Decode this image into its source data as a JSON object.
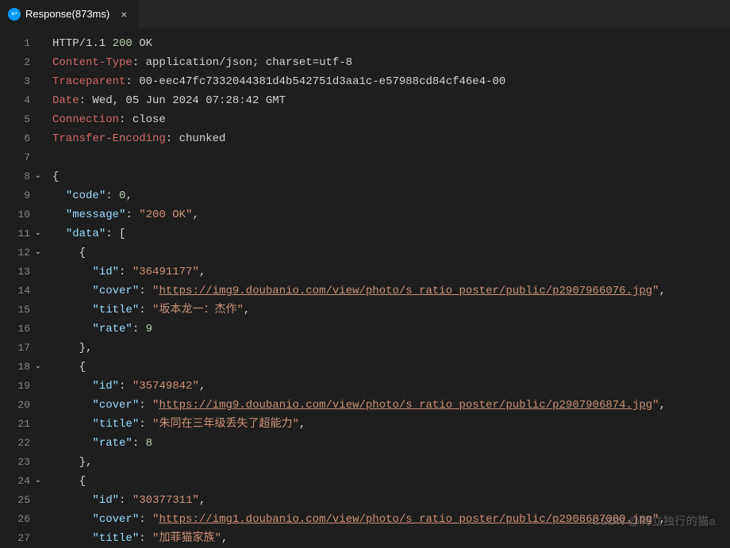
{
  "tab": {
    "title": "Response(873ms)",
    "close_glyph": "×"
  },
  "watermark": "CSDN @特立独行的猫a",
  "lines": [
    {
      "n": "1",
      "fold": "",
      "segs": [
        {
          "t": "HTTP/1.1 ",
          "c": "c-white"
        },
        {
          "t": "200",
          "c": "c-green"
        },
        {
          "t": " OK",
          "c": "c-white"
        }
      ]
    },
    {
      "n": "2",
      "fold": "",
      "segs": [
        {
          "t": "Content-Type",
          "c": "c-red"
        },
        {
          "t": ": application/json; charset=utf-8",
          "c": "c-white"
        }
      ]
    },
    {
      "n": "3",
      "fold": "",
      "segs": [
        {
          "t": "Traceparent",
          "c": "c-red"
        },
        {
          "t": ": 00-eec47fc7332044381d4b542751d3aa1c-e57988cd84cf46e4-00",
          "c": "c-white"
        }
      ]
    },
    {
      "n": "4",
      "fold": "",
      "segs": [
        {
          "t": "Date",
          "c": "c-red"
        },
        {
          "t": ": Wed, 05 Jun 2024 07:28:42 GMT",
          "c": "c-white"
        }
      ]
    },
    {
      "n": "5",
      "fold": "",
      "segs": [
        {
          "t": "Connection",
          "c": "c-red"
        },
        {
          "t": ": close",
          "c": "c-white"
        }
      ]
    },
    {
      "n": "6",
      "fold": "",
      "segs": [
        {
          "t": "Transfer-Encoding",
          "c": "c-red"
        },
        {
          "t": ": chunked",
          "c": "c-white"
        }
      ]
    },
    {
      "n": "7",
      "fold": "",
      "segs": [
        {
          "t": " ",
          "c": "c-white"
        }
      ]
    },
    {
      "n": "8",
      "fold": "v",
      "segs": [
        {
          "t": "{",
          "c": "c-punc"
        }
      ]
    },
    {
      "n": "9",
      "fold": "",
      "segs": [
        {
          "t": "  ",
          "c": "c-punc"
        },
        {
          "t": "\"code\"",
          "c": "c-key"
        },
        {
          "t": ": ",
          "c": "c-punc"
        },
        {
          "t": "0",
          "c": "c-green"
        },
        {
          "t": ",",
          "c": "c-punc"
        }
      ]
    },
    {
      "n": "10",
      "fold": "",
      "segs": [
        {
          "t": "  ",
          "c": "c-punc"
        },
        {
          "t": "\"message\"",
          "c": "c-key"
        },
        {
          "t": ": ",
          "c": "c-punc"
        },
        {
          "t": "\"200 OK\"",
          "c": "c-str"
        },
        {
          "t": ",",
          "c": "c-punc"
        }
      ]
    },
    {
      "n": "11",
      "fold": "v",
      "segs": [
        {
          "t": "  ",
          "c": "c-punc"
        },
        {
          "t": "\"data\"",
          "c": "c-key"
        },
        {
          "t": ": [",
          "c": "c-punc"
        }
      ]
    },
    {
      "n": "12",
      "fold": "v",
      "segs": [
        {
          "t": "    {",
          "c": "c-punc"
        }
      ]
    },
    {
      "n": "13",
      "fold": "",
      "segs": [
        {
          "t": "      ",
          "c": "c-punc"
        },
        {
          "t": "\"id\"",
          "c": "c-key"
        },
        {
          "t": ": ",
          "c": "c-punc"
        },
        {
          "t": "\"36491177\"",
          "c": "c-str"
        },
        {
          "t": ",",
          "c": "c-punc"
        }
      ]
    },
    {
      "n": "14",
      "fold": "",
      "segs": [
        {
          "t": "      ",
          "c": "c-punc"
        },
        {
          "t": "\"cover\"",
          "c": "c-key"
        },
        {
          "t": ": ",
          "c": "c-punc"
        },
        {
          "t": "\"",
          "c": "c-str"
        },
        {
          "t": "https://img9.doubanio.com/view/photo/s_ratio_poster/public/p2907966076.jpg",
          "c": "c-link"
        },
        {
          "t": "\"",
          "c": "c-str"
        },
        {
          "t": ",",
          "c": "c-punc"
        }
      ]
    },
    {
      "n": "15",
      "fold": "",
      "segs": [
        {
          "t": "      ",
          "c": "c-punc"
        },
        {
          "t": "\"title\"",
          "c": "c-key"
        },
        {
          "t": ": ",
          "c": "c-punc"
        },
        {
          "t": "\"坂本龙一：杰作\"",
          "c": "c-str"
        },
        {
          "t": ",",
          "c": "c-punc"
        }
      ]
    },
    {
      "n": "16",
      "fold": "",
      "segs": [
        {
          "t": "      ",
          "c": "c-punc"
        },
        {
          "t": "\"rate\"",
          "c": "c-key"
        },
        {
          "t": ": ",
          "c": "c-punc"
        },
        {
          "t": "9",
          "c": "c-green"
        }
      ]
    },
    {
      "n": "17",
      "fold": "",
      "segs": [
        {
          "t": "    },",
          "c": "c-punc"
        }
      ]
    },
    {
      "n": "18",
      "fold": "v",
      "segs": [
        {
          "t": "    {",
          "c": "c-punc"
        }
      ]
    },
    {
      "n": "19",
      "fold": "",
      "segs": [
        {
          "t": "      ",
          "c": "c-punc"
        },
        {
          "t": "\"id\"",
          "c": "c-key"
        },
        {
          "t": ": ",
          "c": "c-punc"
        },
        {
          "t": "\"35749842\"",
          "c": "c-str"
        },
        {
          "t": ",",
          "c": "c-punc"
        }
      ]
    },
    {
      "n": "20",
      "fold": "",
      "segs": [
        {
          "t": "      ",
          "c": "c-punc"
        },
        {
          "t": "\"cover\"",
          "c": "c-key"
        },
        {
          "t": ": ",
          "c": "c-punc"
        },
        {
          "t": "\"",
          "c": "c-str"
        },
        {
          "t": "https://img9.doubanio.com/view/photo/s_ratio_poster/public/p2907906874.jpg",
          "c": "c-link"
        },
        {
          "t": "\"",
          "c": "c-str"
        },
        {
          "t": ",",
          "c": "c-punc"
        }
      ]
    },
    {
      "n": "21",
      "fold": "",
      "segs": [
        {
          "t": "      ",
          "c": "c-punc"
        },
        {
          "t": "\"title\"",
          "c": "c-key"
        },
        {
          "t": ": ",
          "c": "c-punc"
        },
        {
          "t": "\"朱同在三年级丢失了超能力\"",
          "c": "c-str"
        },
        {
          "t": ",",
          "c": "c-punc"
        }
      ]
    },
    {
      "n": "22",
      "fold": "",
      "segs": [
        {
          "t": "      ",
          "c": "c-punc"
        },
        {
          "t": "\"rate\"",
          "c": "c-key"
        },
        {
          "t": ": ",
          "c": "c-punc"
        },
        {
          "t": "8",
          "c": "c-green"
        }
      ]
    },
    {
      "n": "23",
      "fold": "",
      "segs": [
        {
          "t": "    },",
          "c": "c-punc"
        }
      ]
    },
    {
      "n": "24",
      "fold": "v",
      "segs": [
        {
          "t": "    {",
          "c": "c-punc"
        }
      ]
    },
    {
      "n": "25",
      "fold": "",
      "segs": [
        {
          "t": "      ",
          "c": "c-punc"
        },
        {
          "t": "\"id\"",
          "c": "c-key"
        },
        {
          "t": ": ",
          "c": "c-punc"
        },
        {
          "t": "\"30377311\"",
          "c": "c-str"
        },
        {
          "t": ",",
          "c": "c-punc"
        }
      ]
    },
    {
      "n": "26",
      "fold": "",
      "segs": [
        {
          "t": "      ",
          "c": "c-punc"
        },
        {
          "t": "\"cover\"",
          "c": "c-key"
        },
        {
          "t": ": ",
          "c": "c-punc"
        },
        {
          "t": "\"",
          "c": "c-str"
        },
        {
          "t": "https://img1.doubanio.com/view/photo/s_ratio_poster/public/p2908687080.jpg",
          "c": "c-link"
        },
        {
          "t": "\"",
          "c": "c-str"
        },
        {
          "t": ",",
          "c": "c-punc"
        }
      ]
    },
    {
      "n": "27",
      "fold": "",
      "segs": [
        {
          "t": "      ",
          "c": "c-punc"
        },
        {
          "t": "\"title\"",
          "c": "c-key"
        },
        {
          "t": ": ",
          "c": "c-punc"
        },
        {
          "t": "\"加菲猫家族\"",
          "c": "c-str"
        },
        {
          "t": ",",
          "c": "c-punc"
        }
      ]
    }
  ]
}
